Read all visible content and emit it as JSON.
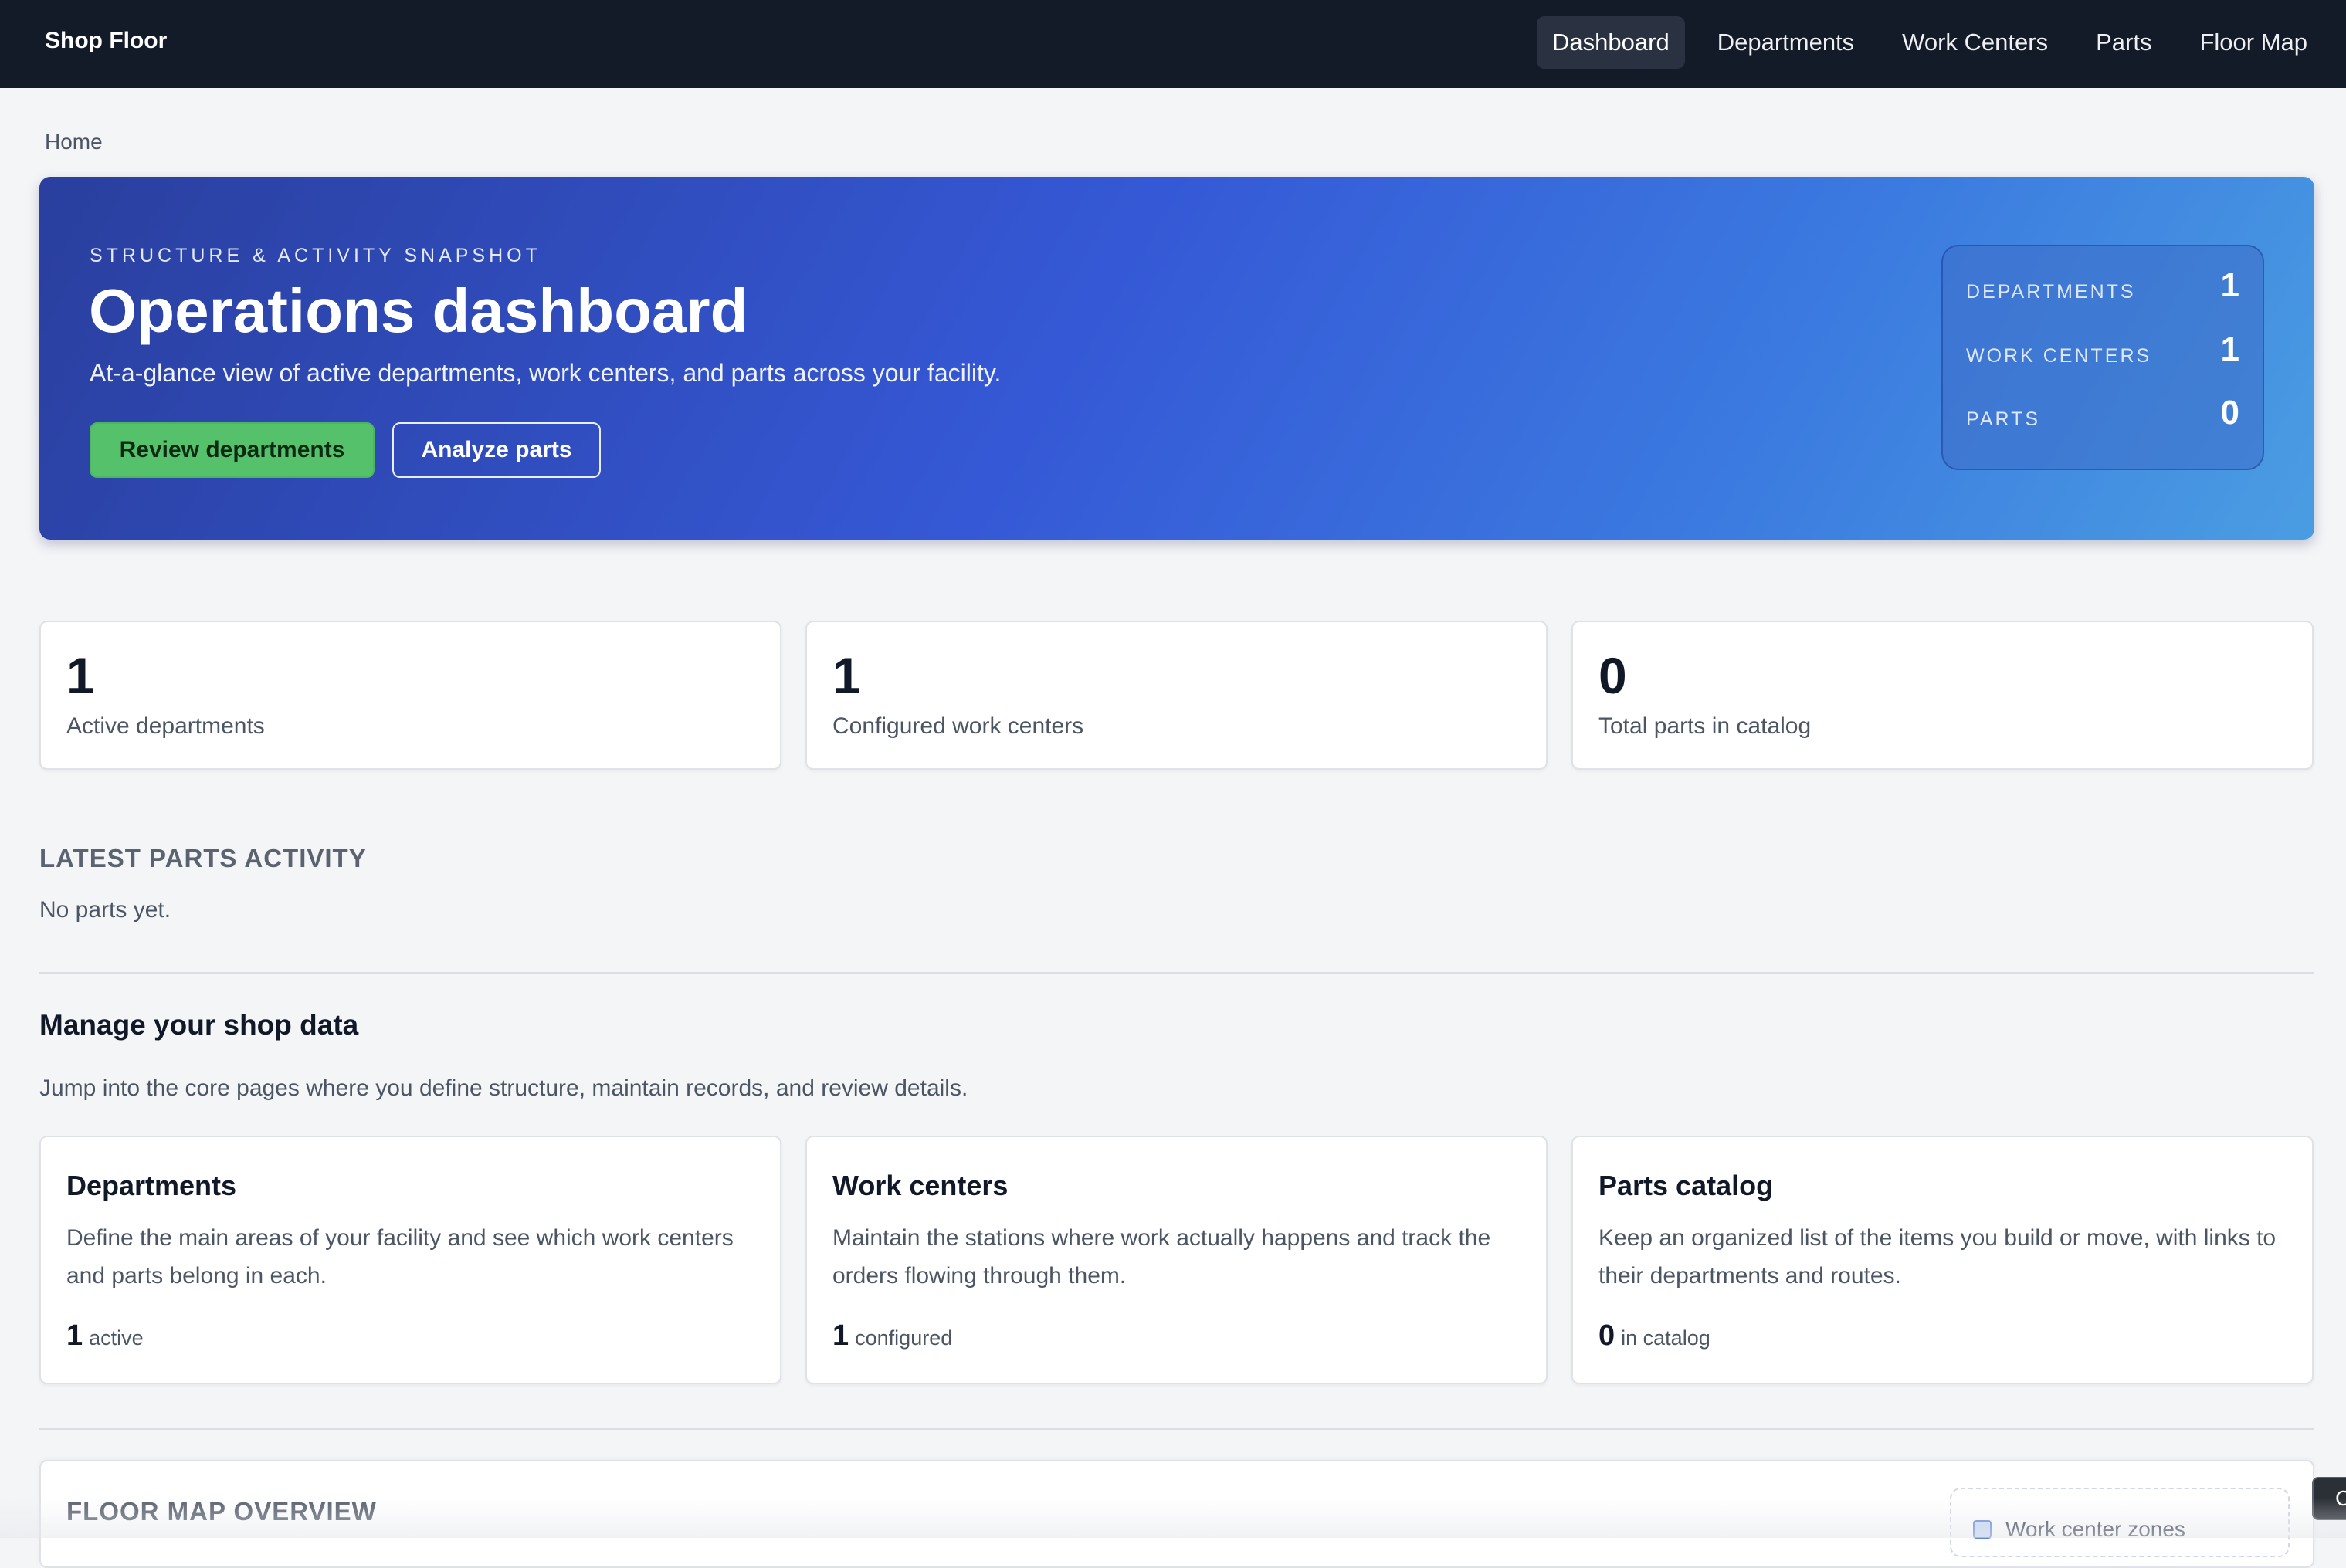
{
  "nav": {
    "brand": "Shop Floor",
    "links": [
      {
        "label": "Dashboard",
        "active": true
      },
      {
        "label": "Departments",
        "active": false
      },
      {
        "label": "Work Centers",
        "active": false
      },
      {
        "label": "Parts",
        "active": false
      },
      {
        "label": "Floor Map",
        "active": false
      }
    ]
  },
  "breadcrumb": "Home",
  "hero": {
    "eyebrow": "STRUCTURE & ACTIVITY SNAPSHOT",
    "title": "Operations dashboard",
    "subtitle": "At-a-glance view of active departments, work centers, and parts across your facility.",
    "primary_button": "Review departments",
    "secondary_button": "Analyze parts",
    "stats": [
      {
        "label": "DEPARTMENTS",
        "value": "1"
      },
      {
        "label": "WORK CENTERS",
        "value": "1"
      },
      {
        "label": "PARTS",
        "value": "0"
      }
    ]
  },
  "kpis": [
    {
      "value": "1",
      "label": "Active departments"
    },
    {
      "value": "1",
      "label": "Configured work centers"
    },
    {
      "value": "0",
      "label": "Total parts in catalog"
    }
  ],
  "latest": {
    "heading": "LATEST PARTS ACTIVITY",
    "empty": "No parts yet."
  },
  "manage": {
    "title": "Manage your shop data",
    "description": "Jump into the core pages where you define structure, maintain records, and review details.",
    "cards": [
      {
        "title": "Departments",
        "description": "Define the main areas of your facility and see which work centers and parts belong in each.",
        "count": "1",
        "unit": "active"
      },
      {
        "title": "Work centers",
        "description": "Maintain the stations where work actually happens and track the orders flowing through them.",
        "count": "1",
        "unit": "configured"
      },
      {
        "title": "Parts catalog",
        "description": "Keep an organized list of the items you build or move, with links to their departments and routes.",
        "count": "0",
        "unit": "in catalog"
      }
    ]
  },
  "floor_map": {
    "title": "FLOOR MAP OVERVIEW",
    "legend_label": "Work center zones"
  },
  "floating_button": "C",
  "colors": {
    "nav_bg": "#131a28",
    "hero_start": "#2a3f9e",
    "hero_end": "#4a9de2",
    "primary_button": "#55c26b"
  }
}
